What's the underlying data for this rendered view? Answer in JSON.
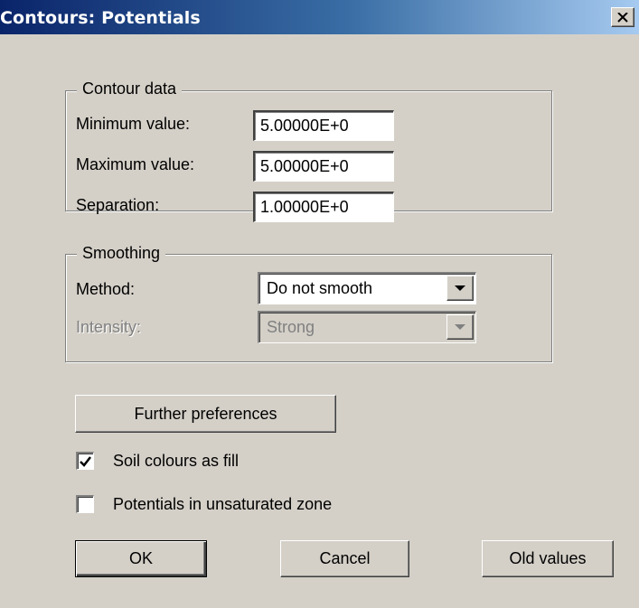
{
  "window": {
    "title": "Contours: Potentials",
    "close_label": "×"
  },
  "contour_data": {
    "legend": "Contour data",
    "minimum": {
      "label": "Minimum value:",
      "value": "5.00000E+0"
    },
    "maximum": {
      "label": "Maximum value:",
      "value": "5.00000E+0"
    },
    "separation": {
      "label": "Separation:",
      "value": "1.00000E+0"
    }
  },
  "smoothing": {
    "legend": "Smoothing",
    "method": {
      "label": "Method:",
      "value": "Do not smooth"
    },
    "intensity": {
      "label": "Intensity:",
      "value": "Strong"
    }
  },
  "further_preferences_label": "Further preferences",
  "checkboxes": {
    "soil_colours": {
      "label": "Soil colours as fill",
      "checked": true
    },
    "potentials_unsaturated": {
      "label": "Potentials in unsaturated zone",
      "checked": false
    }
  },
  "buttons": {
    "ok": "OK",
    "cancel": "Cancel",
    "old_values": "Old values"
  },
  "colors": {
    "face": "#d4d0c8",
    "title_start": "#0a246a",
    "title_end": "#a6caf0"
  }
}
